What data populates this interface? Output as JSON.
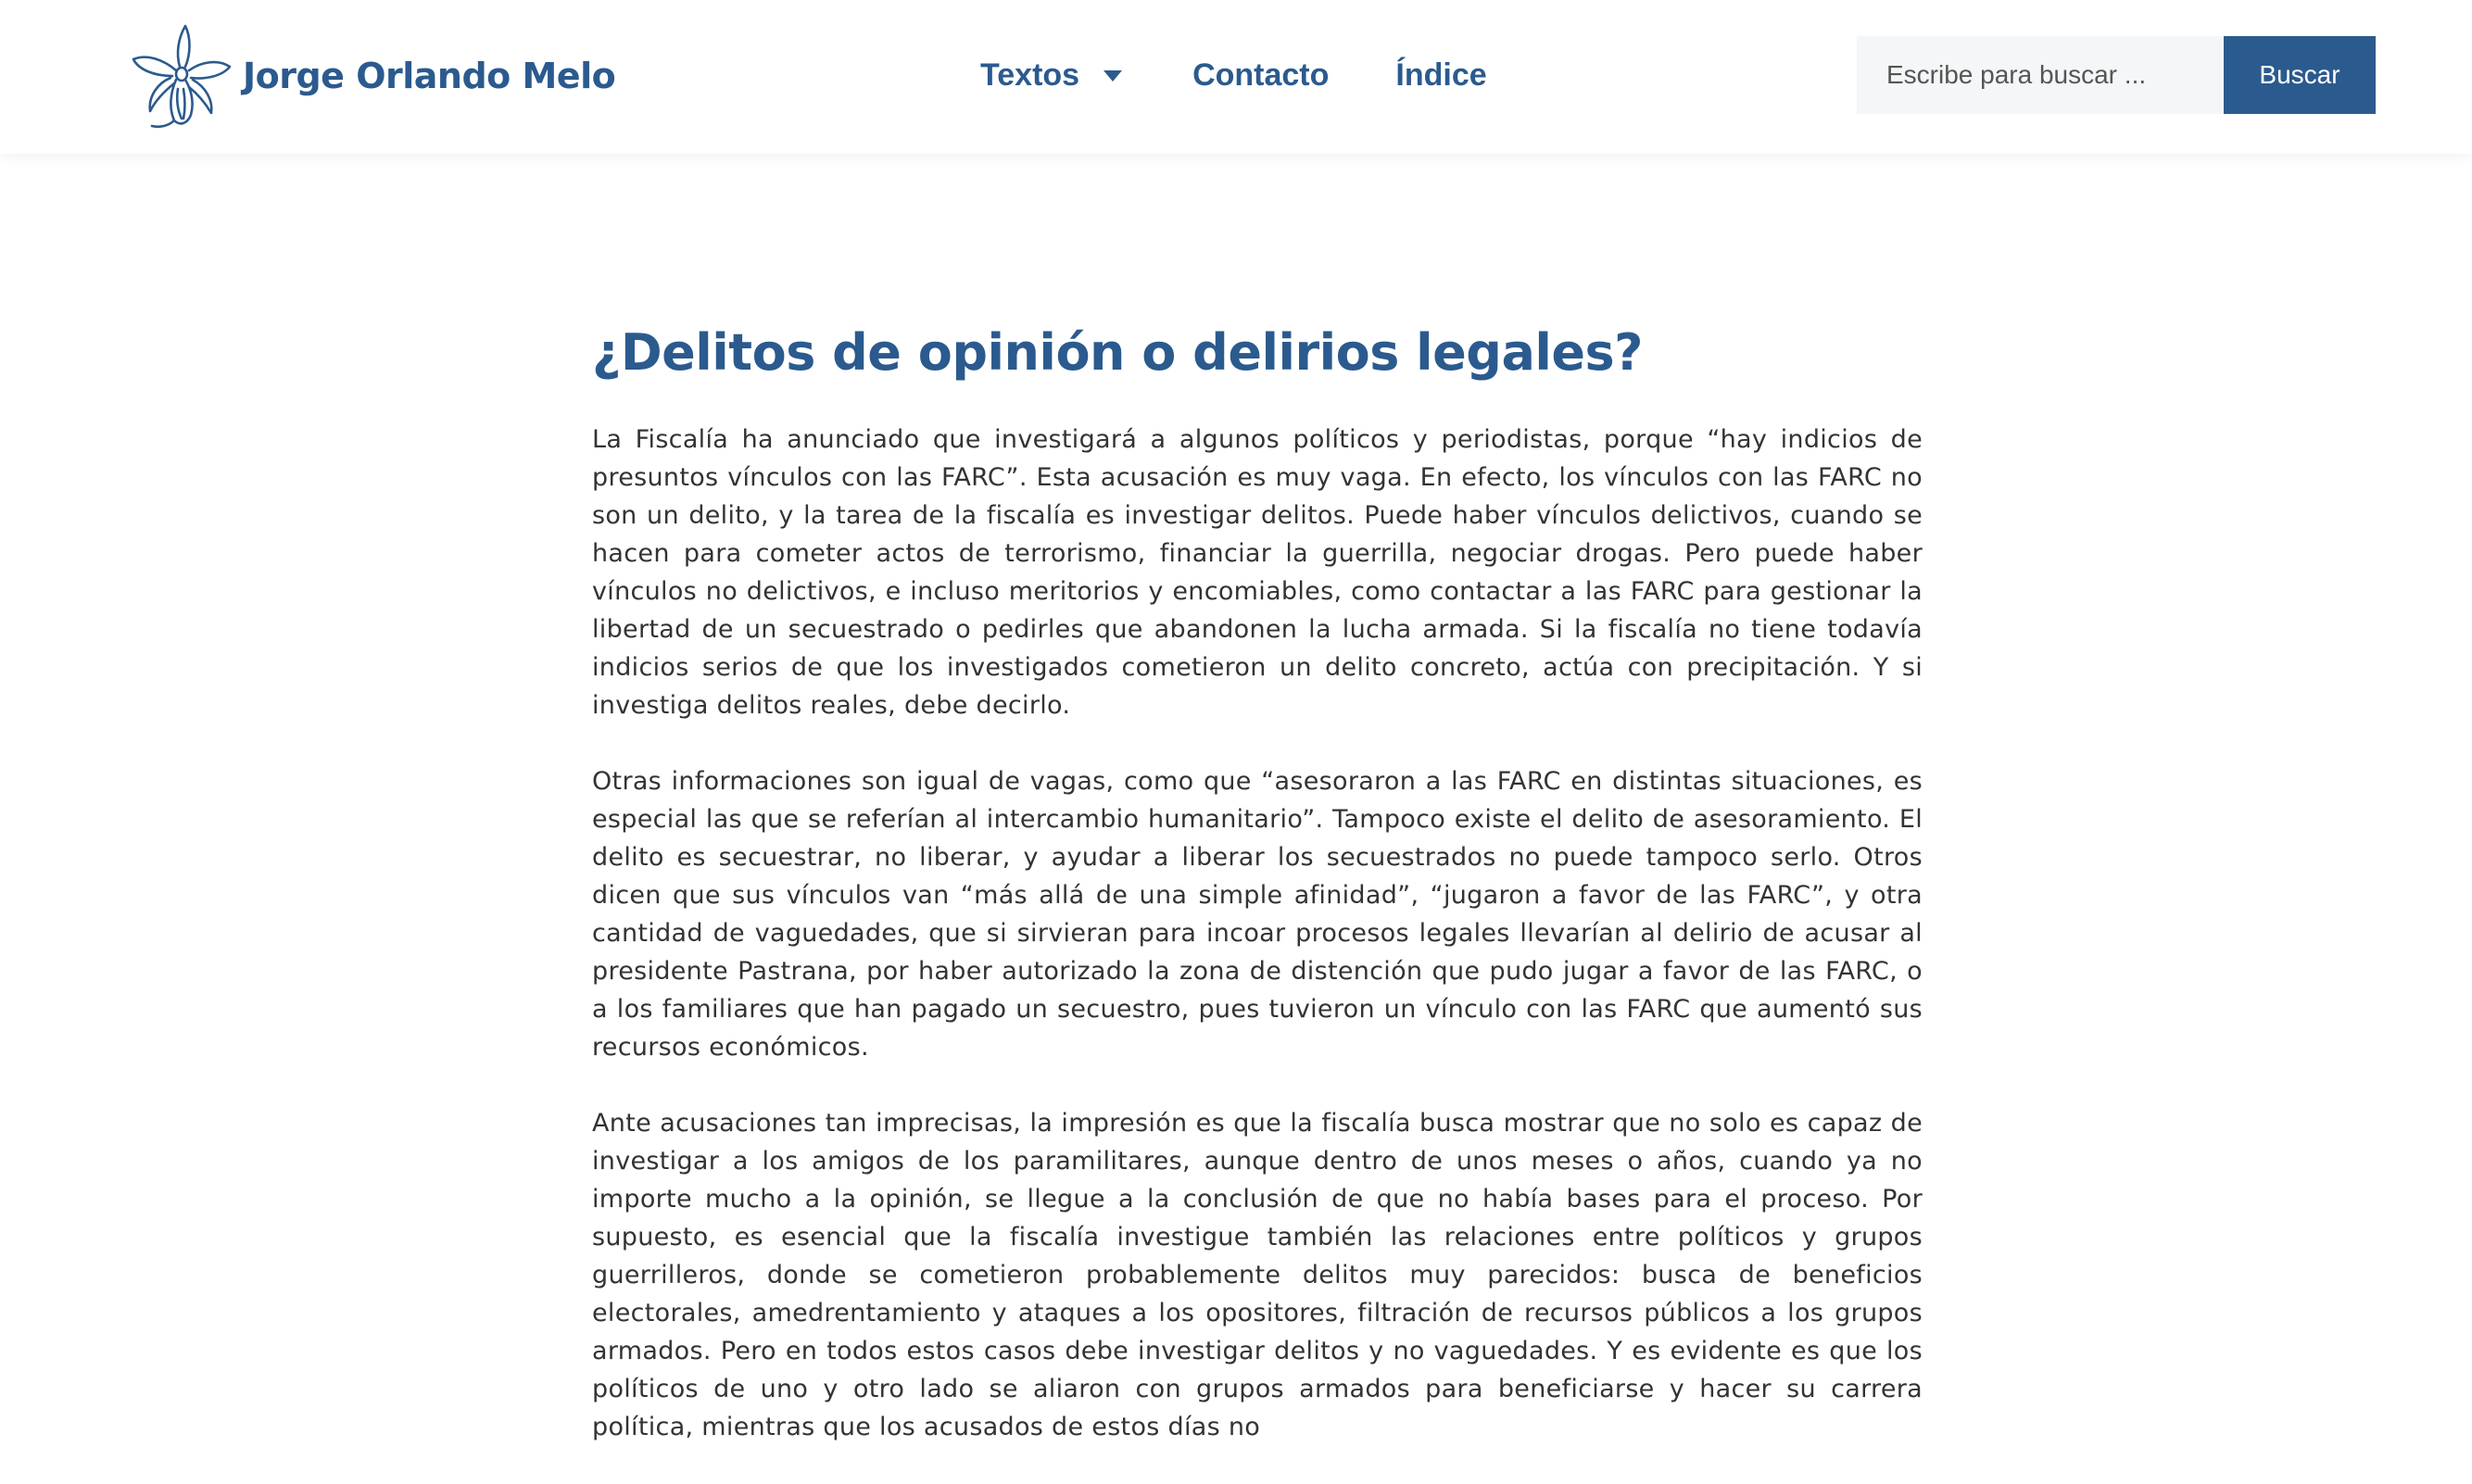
{
  "header": {
    "brand_name": "Jorge Orlando Melo",
    "logo_icon": "orchid-flower-icon",
    "accent_color": "#2b5a8e",
    "nav": {
      "textos": "Textos",
      "contacto": "Contacto",
      "indice": "Índice"
    },
    "search": {
      "placeholder": "Escribe para buscar ...",
      "value": "",
      "button_label": "Buscar"
    }
  },
  "article": {
    "title": "¿Delitos de opinión o delirios legales?",
    "paragraphs": [
      "La Fiscalía ha anunciado que investigará a algunos políticos y  periodistas, porque “hay indicios de presuntos vínculos con las FARC”. Esta acusación es muy vaga. En efecto, los vínculos con las FARC no son un delito, y la tarea de la fiscalía es investigar delitos. Puede haber vínculos delictivos, cuando se hacen para cometer actos de terrorismo, financiar la guerrilla, negociar drogas. Pero puede haber vínculos no delictivos, e incluso meritorios y encomiables, como contactar a las FARC para gestionar la libertad de un secuestrado o pedirles que abandonen la lucha armada. Si la fiscalía no tiene todavía indicios serios de que los investigados cometieron un delito concreto, actúa con precipitación. Y si investiga delitos reales, debe decirlo.",
      "Otras informaciones son igual de vagas, como que  “asesoraron a las FARC en distintas situaciones, es especial las que se referían al intercambio humanitario”. Tampoco existe el delito de asesoramiento. El delito es secuestrar, no liberar, y ayudar a liberar los secuestrados no puede tampoco serlo. Otros dicen que sus vínculos van “más allá de una simple afinidad”, “jugaron a favor de las FARC”, y otra cantidad de vaguedades, que si sirvieran para incoar procesos legales llevarían al delirio de acusar al presidente Pastrana, por haber autorizado la zona de distención que pudo jugar a favor de las FARC, o a los familiares que han pagado un secuestro, pues tuvieron un vínculo con las FARC que aumentó sus recursos económicos.",
      "Ante acusaciones tan imprecisas, la impresión es que la fiscalía busca mostrar que no solo es capaz de investigar a los amigos de los paramilitares, aunque dentro de unos meses o años, cuando ya no importe mucho a la opinión, se llegue a la conclusión de que no había bases para el proceso. Por supuesto, es esencial que la fiscalía investigue también las relaciones entre políticos y grupos guerrilleros, donde se cometieron probablemente delitos muy parecidos: busca de beneficios electorales, amedrentamiento y ataques a los opositores, filtración de recursos públicos a los grupos armados. Pero en todos estos casos debe investigar delitos y no vaguedades. Y es evidente es que los políticos de uno y otro lado se aliaron con grupos armados para beneficiarse y hacer su carrera política, mientras que los acusados de estos días no"
    ]
  }
}
